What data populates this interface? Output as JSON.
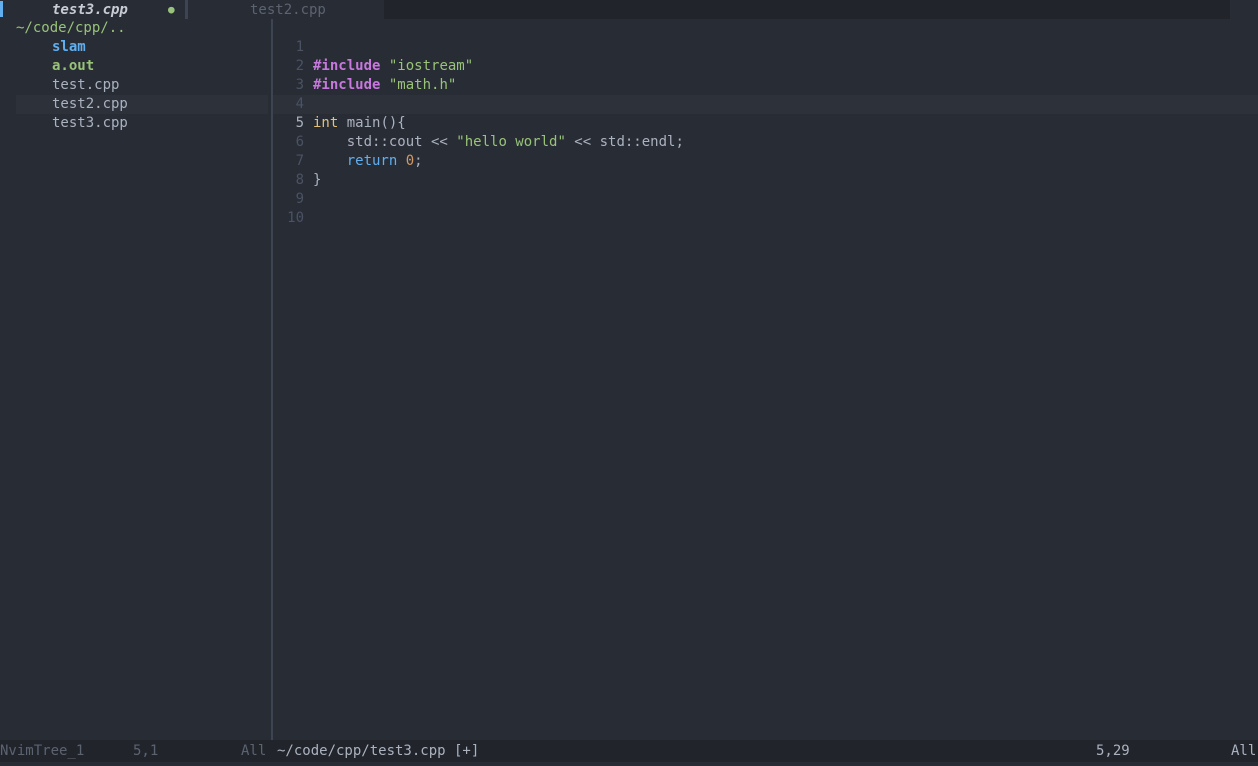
{
  "tabline": {
    "active_tab": "test3.cpp",
    "active_modified_marker": "●",
    "inactive_tab": "test2.cpp"
  },
  "tree": {
    "root": "~/code/cpp/..",
    "entries": [
      {
        "name": "slam",
        "kind": "directory"
      },
      {
        "name": "a.out",
        "kind": "executable"
      },
      {
        "name": "test.cpp",
        "kind": "file"
      },
      {
        "name": "test2.cpp",
        "kind": "file"
      },
      {
        "name": "test3.cpp",
        "kind": "file"
      }
    ]
  },
  "editor": {
    "line_numbers": [
      "1",
      "2",
      "3",
      "4",
      "5",
      "6",
      "7",
      "8",
      "9",
      "10"
    ],
    "current_line": "5",
    "tokens": {
      "l1_directive": "#include",
      "l1_string": "\"iostream\"",
      "l2_directive": "#include",
      "l2_string": "\"math.h\"",
      "l4_type": "int",
      "l4_rest": "main(){",
      "l5_a": "std::cout << ",
      "l5_string": "\"hello world\"",
      "l5_b": " << std::endl;",
      "l6_keyword": "return",
      "l6_number": "0",
      "l6_rest": ";",
      "l7": "}"
    }
  },
  "statusline": {
    "tree_name": "NvimTree_1",
    "tree_pos": "5,1",
    "tree_scroll": "All",
    "file_path": "~/code/cpp/test3.cpp [+]",
    "file_pos": "5,29",
    "file_scroll": "All"
  }
}
